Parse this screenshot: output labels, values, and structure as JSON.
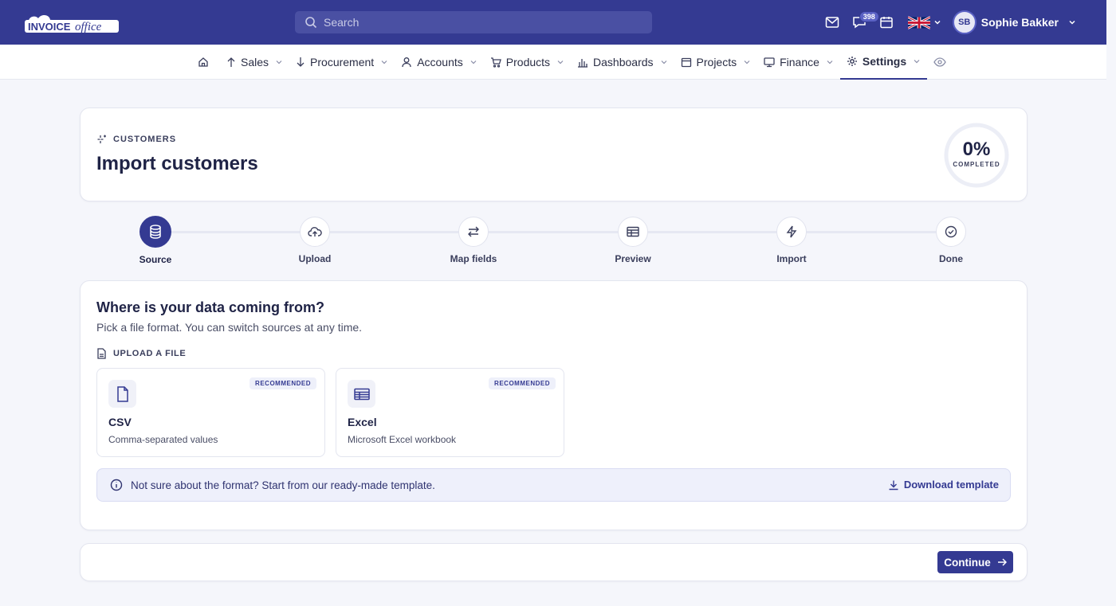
{
  "brand": {
    "logo_text": "invoiceoffice"
  },
  "search": {
    "placeholder": "Search"
  },
  "top_icons": {
    "mail": "mail-icon",
    "chat": "chat-icon",
    "chat_badge": "398",
    "calendar": "calendar-icon"
  },
  "user": {
    "initials": "SB",
    "name": "Sophie Bakker"
  },
  "nav": [
    {
      "label": "Sales"
    },
    {
      "label": "Procurement"
    },
    {
      "label": "Accounts"
    },
    {
      "label": "Products"
    },
    {
      "label": "Dashboards"
    },
    {
      "label": "Projects"
    },
    {
      "label": "Finance"
    },
    {
      "label": "Settings"
    }
  ],
  "header": {
    "eyebrow": "CUSTOMERS",
    "title": "Import customers",
    "progress_pct": "0%",
    "progress_label": "COMPLETED",
    "progress_value": 0
  },
  "steps": [
    {
      "label": "Source",
      "active": true
    },
    {
      "label": "Upload"
    },
    {
      "label": "Map fields"
    },
    {
      "label": "Preview"
    },
    {
      "label": "Import"
    },
    {
      "label": "Done"
    }
  ],
  "source": {
    "question": "Where is your data coming from?",
    "subtitle": "Pick a file format. You can switch sources at any time.",
    "section_label": "UPLOAD A FILE",
    "options": [
      {
        "name": "CSV",
        "desc": "Comma-separated values",
        "badge": "RECOMMENDED"
      },
      {
        "name": "Excel",
        "desc": "Microsoft Excel workbook",
        "badge": "RECOMMENDED"
      }
    ],
    "info_text": "Not sure about the format? Start from our ready-made template.",
    "download_label": "Download template"
  },
  "footer": {
    "continue_label": "Continue"
  },
  "colors": {
    "primary": "#343a92",
    "background": "#f5f6fb"
  }
}
